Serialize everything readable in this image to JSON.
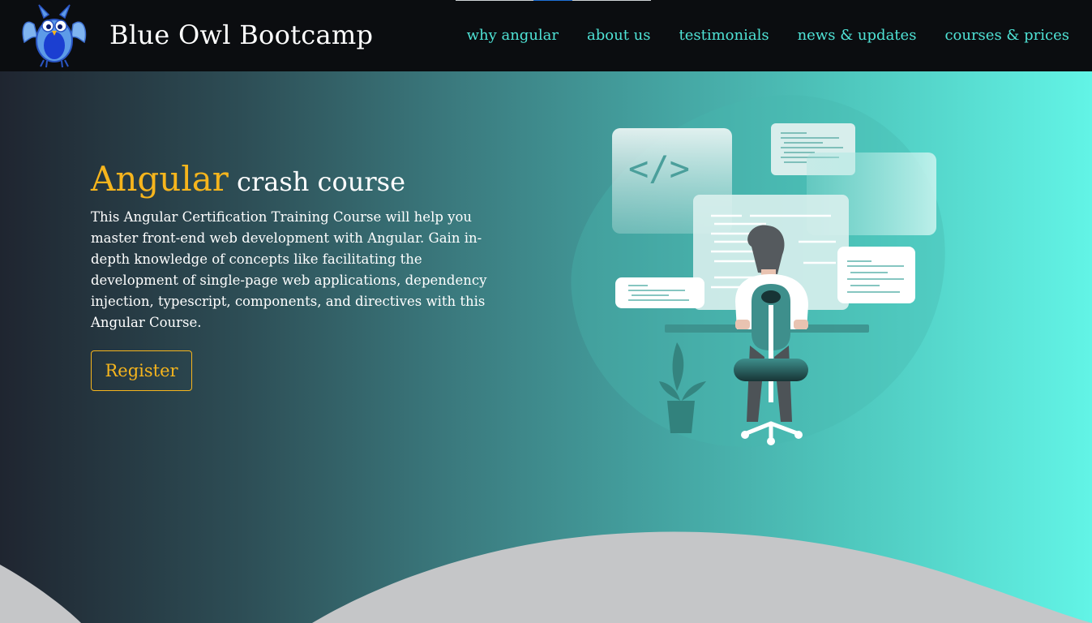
{
  "brand": {
    "name": "Blue Owl Bootcamp",
    "logo_icon": "owl-logo-icon"
  },
  "nav": {
    "links": [
      {
        "label": "why angular"
      },
      {
        "label": "about us"
      },
      {
        "label": "testimonials"
      },
      {
        "label": "news & updates"
      },
      {
        "label": "courses & prices"
      }
    ]
  },
  "hero": {
    "title_accent": "Angular",
    "title_rest": "crash course",
    "description": "This Angular Certification Training Course will help you master front-end web development with Angular. Gain in-depth knowledge of concepts like facilitating the development of single-page web applications, dependency injection, typescript, components, and directives with this Angular Course.",
    "register_label": "Register",
    "code_symbol": "</>",
    "illustration_icon": "developer-at-desk-illustration"
  },
  "colors": {
    "accent": "#f6b51d",
    "nav_link": "#4fe3d6",
    "navbar_bg": "#0b0d10",
    "gradient_start": "#1f2530",
    "gradient_end": "#62f4e6",
    "wave": "#c5c6c8"
  }
}
